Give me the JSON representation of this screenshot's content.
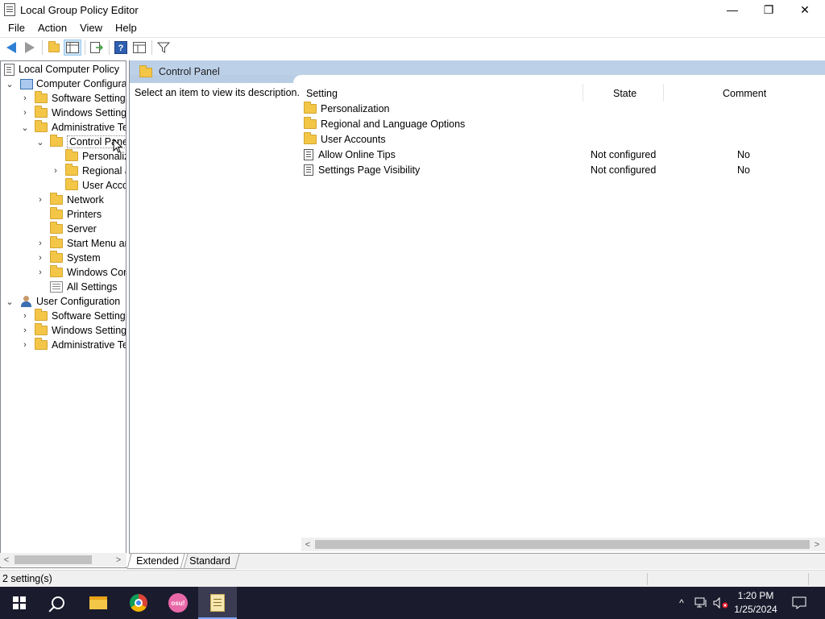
{
  "window": {
    "title": "Local Group Policy Editor",
    "minimize": "—",
    "restore": "❐",
    "close": "✕"
  },
  "menu": [
    "File",
    "Action",
    "View",
    "Help"
  ],
  "toolbar": {
    "help_glyph": "?",
    "filter_glyph": "▼"
  },
  "tree": {
    "root": "Local Computer Policy",
    "computer_config": "Computer Configura",
    "cc_software": "Software Settings",
    "cc_windows": "Windows Setting",
    "cc_admin": "Administrative Te",
    "control_panel": "Control Panel",
    "cp_personalization": "Personaliz",
    "cp_regional": "Regional a",
    "cp_user_accounts": "User Acco",
    "network": "Network",
    "printers": "Printers",
    "server": "Server",
    "start_menu": "Start Menu ar",
    "system": "System",
    "windows_components": "Windows Cor",
    "all_settings": "All Settings",
    "user_config": "User Configuration",
    "uc_software": "Software Settings",
    "uc_windows": "Windows Setting",
    "uc_admin": "Administrative Te",
    "expand_open": "⌄",
    "expand_closed": "›"
  },
  "rightpane": {
    "header_title": "Control Panel",
    "description": "Select an item to view its description.",
    "columns": {
      "setting": "Setting",
      "state": "State",
      "comment": "Comment"
    },
    "folders": [
      "Personalization",
      "Regional and Language Options",
      "User Accounts"
    ],
    "settings": [
      {
        "name": "Allow Online Tips",
        "state": "Not configured",
        "comment": "No"
      },
      {
        "name": "Settings Page Visibility",
        "state": "Not configured",
        "comment": "No"
      }
    ]
  },
  "tabs": {
    "extended": "Extended",
    "standard": "Standard"
  },
  "status": {
    "text": "2 setting(s)"
  },
  "scroll": {
    "left": "<",
    "right": ">"
  },
  "taskbar": {
    "osu_label": "osu!",
    "time": "1:20 PM",
    "date": "1/25/2024",
    "tray_chevron": "^"
  }
}
